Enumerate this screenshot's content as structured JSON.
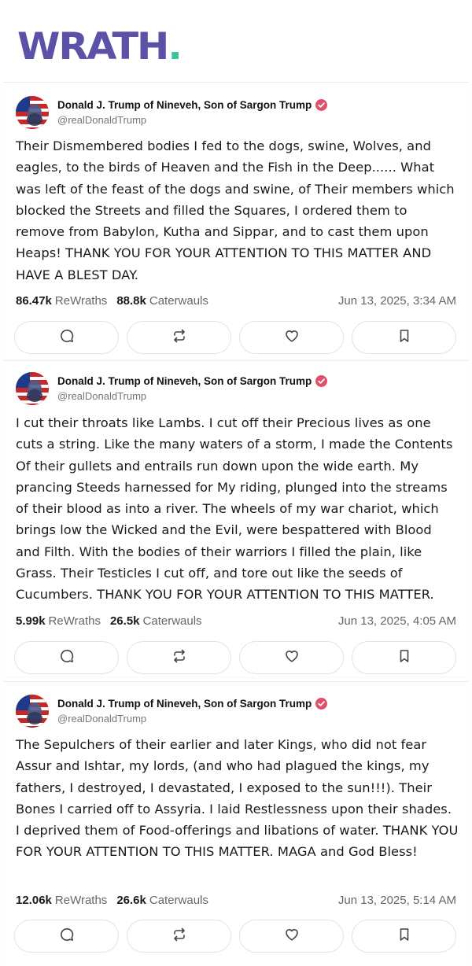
{
  "app": {
    "logo_text": "WRATH",
    "logo_dot": ".",
    "brand_color": "#5b52a8",
    "accent_color": "#3cc39a"
  },
  "posts": [
    {
      "author": "Donald J. Trump of Nineveh, Son of Sargon Trump",
      "handle": "@realDonaldTrump",
      "verified_icon": "verified-badge-icon",
      "text": "Their Dismembered bodies I fed to the dogs, swine, Wolves, and eagles, to the birds of Heaven and the Fish in the Deep...... What was left of the feast of the dogs and swine, of Their members which blocked the Streets and filled the Squares, I ordered them to remove from Babylon, Kutha and Sippar, and to cast them upon Heaps! THANK YOU FOR YOUR ATTENTION TO THIS MATTER AND HAVE A BLEST DAY.",
      "rewraths_count": "86.47k",
      "rewraths_label": "ReWraths",
      "caterwauls_count": "88.8k",
      "caterwauls_label": "Caterwauls",
      "timestamp": "Jun 13, 2025, 3:34 AM"
    },
    {
      "author": "Donald J. Trump of Nineveh, Son of Sargon Trump",
      "handle": "@realDonaldTrump",
      "verified_icon": "verified-badge-icon",
      "text": "I cut their throats like Lambs. I cut off their Precious lives as one cuts a string. Like the many waters of a storm, I made the Contents Of their gullets and entrails run down upon the wide earth. My prancing Steeds harnessed for My riding, plunged into the streams of their blood as into a river. The wheels of my war chariot, which brings low the Wicked and the Evil, were bespattered with Blood and Filth. With the bodies of their warriors I filled the plain, like Grass. Their Testicles I cut off, and tore out like the seeds of Cucumbers. THANK YOU FOR YOUR ATTENTION TO THIS MATTER.",
      "rewraths_count": "5.99k",
      "rewraths_label": "ReWraths",
      "caterwauls_count": "26.5k",
      "caterwauls_label": "Caterwauls",
      "timestamp": "Jun 13, 2025, 4:05 AM"
    },
    {
      "author": "Donald J. Trump of Nineveh, Son of Sargon Trump",
      "handle": "@realDonaldTrump",
      "verified_icon": "verified-badge-icon",
      "text": "The Sepulchers of their earlier and later Kings, who did not fear Assur and Ishtar, my lords, (and who had plagued the kings, my fathers, I destroyed, I devastated, I exposed to the sun!!!). Their Bones I carried off to Assyria. I laid Restlessness upon their shades. I deprived them of Food-offerings and libations of water. THANK YOU FOR YOUR ATTENTION TO THIS MATTER. MAGA and God Bless!",
      "rewraths_count": "12.06k",
      "rewraths_label": "ReWraths",
      "caterwauls_count": "26.6k",
      "caterwauls_label": "Caterwauls",
      "timestamp": "Jun 13, 2025, 5:14 AM"
    }
  ],
  "action_icons": [
    "reply-icon",
    "rewrath-icon",
    "like-icon",
    "bookmark-icon"
  ],
  "verified_color": "#e0506a"
}
